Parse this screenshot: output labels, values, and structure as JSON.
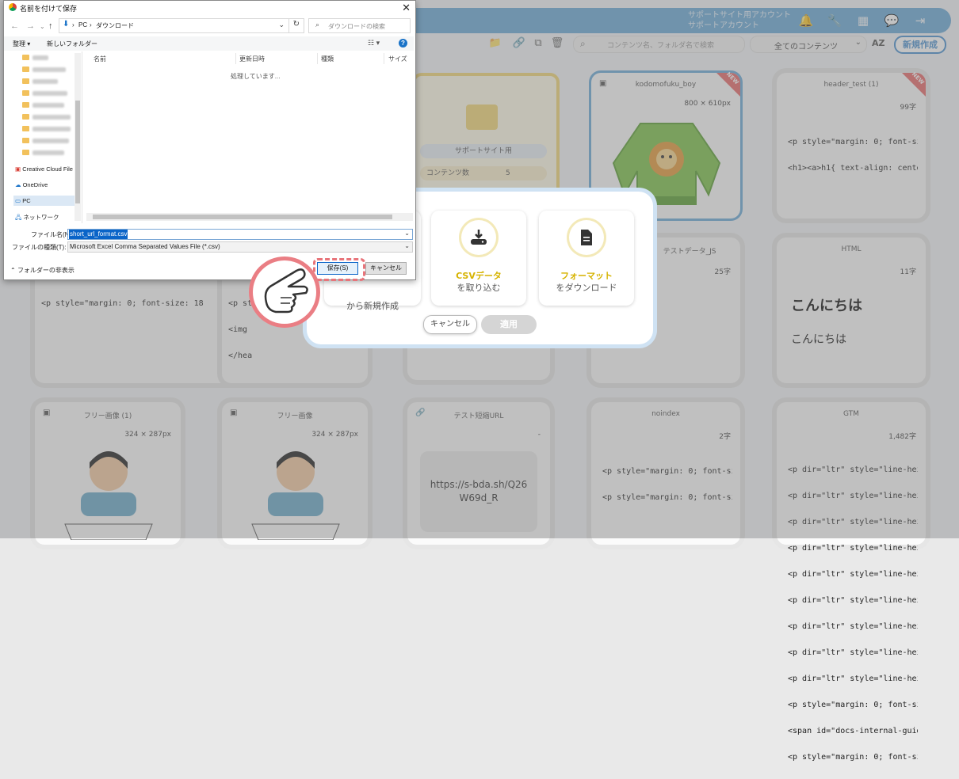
{
  "app": {
    "account_line1": "サポートサイト用アカウント",
    "account_line2": "サポートアカウント",
    "search_placeholder": "コンテンツ名、フォルダ名で検索",
    "filter_value": "全てのコンテンツ",
    "sort_label": "AZ",
    "new_button": "新規作成",
    "cards": [
      {
        "title": "kodomofuku_boy",
        "meta": "800 × 610px",
        "badge": "NEW"
      },
      {
        "title": "header_test (1)",
        "meta": "99字",
        "badge": "NEW",
        "code": [
          "<p style=\"margin: 0; font-size: 18",
          "<h1><a>h1{ text-align: center; fo"
        ]
      },
      {
        "title": "サポートサイト用",
        "stat_label": "コンテンツ数",
        "stat_value": "5"
      },
      {
        "title": "テストデータ_JS",
        "meta": "25字"
      },
      {
        "title": "HTML",
        "meta": "11字",
        "heading": "こんにちは",
        "body": "こんにちは"
      },
      {
        "title": "フリー画像 (1)",
        "meta": "324 × 287px"
      },
      {
        "title": "フリー画像",
        "meta": "324 × 287px"
      },
      {
        "title": "テスト短縮URL",
        "meta": "-",
        "url": "https://s-bda.sh/Q26W69d_R"
      },
      {
        "title": "noindex",
        "meta": "2字",
        "code": [
          "<p style=\"margin: 0; font-size: 18",
          "<p style=\"margin: 0; font-size: 18"
        ]
      },
      {
        "title": "GTM",
        "meta": "1,482字",
        "code": [
          "<p dir=\"ltr\" style=\"line-height: 1",
          "<p dir=\"ltr\" style=\"line-height: 1",
          "<p dir=\"ltr\" style=\"line-height: 1",
          "<p dir=\"ltr\" style=\"line-height: 1",
          "<p dir=\"ltr\" style=\"line-height: 1",
          "<p dir=\"ltr\" style=\"line-height: 1",
          "<p dir=\"ltr\" style=\"line-height: 1",
          "<p dir=\"ltr\" style=\"line-height: 1",
          "<p dir=\"ltr\" style=\"line-height: 1",
          "<p style=\"margin: 0; font-size: 18",
          "<span id=\"docs-internal-guid-390",
          "<p style=\"margin: 0; font-size: 18"
        ]
      },
      {
        "code": [
          "<p style=\"margin: 0; font-size: 18"
        ]
      },
      {
        "code": [
          "<p st",
          "<img",
          "</hea"
        ]
      }
    ]
  },
  "modal": {
    "option1_line2": "から新規作成",
    "option2_line1": "CSVデータ",
    "option2_line2": "を取り込む",
    "option3_line1": "フォーマット",
    "option3_line2": "をダウンロード",
    "cancel": "キャンセル",
    "apply": "適用"
  },
  "dialog": {
    "title": "名前を付けて保存",
    "breadcrumb": [
      "PC",
      "ダウンロード"
    ],
    "search_placeholder": "ダウンロードの検索",
    "organize": "整理 ▾",
    "new_folder": "新しいフォルダー",
    "columns": [
      "名前",
      "更新日時",
      "種類",
      "サイズ"
    ],
    "processing": "処理しています...",
    "nav_items": [
      "Creative Cloud File",
      "OneDrive",
      "PC",
      "ネットワーク"
    ],
    "filename_label": "ファイル名(N):",
    "filename_value": "short_url_format.csv",
    "filetype_label": "ファイルの種類(T):",
    "filetype_value": "Microsoft Excel Comma Separated Values File (*.csv)",
    "hide_folders": "フォルダーの非表示",
    "save": "保存(S)",
    "cancel": "キャンセル"
  },
  "colors": {
    "topbar": "#6aa9d8",
    "accent_yellow": "#d6b300",
    "new_badge": "#e86b6b",
    "hand_circle": "#ea7e84"
  }
}
